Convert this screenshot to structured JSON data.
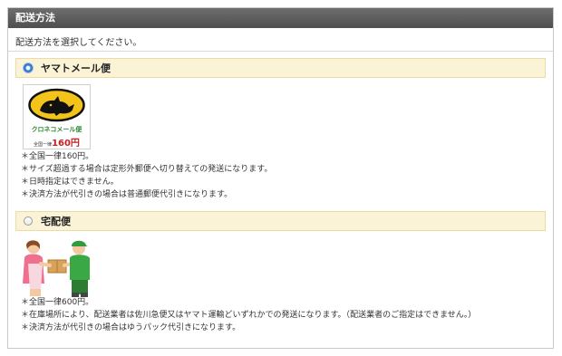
{
  "panel": {
    "title": "配送方法"
  },
  "instruction": "配送方法を選択してください。",
  "options": [
    {
      "label": "ヤマトメール便",
      "selected": true,
      "logo": {
        "brand": "クロネコメール便",
        "price_prefix": "全国一律",
        "price": "160円"
      },
      "notes": [
        "＊全国一律160円。",
        "＊サイズ超過する場合は定形外郵便へ切り替えての発送になります。",
        "＊日時指定はできません。",
        "＊決済方法が代引きの場合は普通郵便代引きになります。"
      ]
    },
    {
      "label": "宅配便",
      "selected": false,
      "notes": [
        "＊全国一律600円。",
        "＊在庫場所により、配送業者は佐川急便又はヤマト運輸どいずれかでの発送になります。（配送業者のご指定はできません。）",
        "＊決済方法が代引きの場合はゆうパック代引きになります。"
      ]
    }
  ],
  "colors": {
    "header_bg": "#5a5a5a",
    "option_bar_bg": "#fbf3d6",
    "radio_selected": "#2d6fcf",
    "logo_price": "#c42020",
    "logo_brand": "#2e8b35"
  },
  "icons": [
    "kuroneko-logo-icon",
    "delivery-handoff-icon"
  ]
}
